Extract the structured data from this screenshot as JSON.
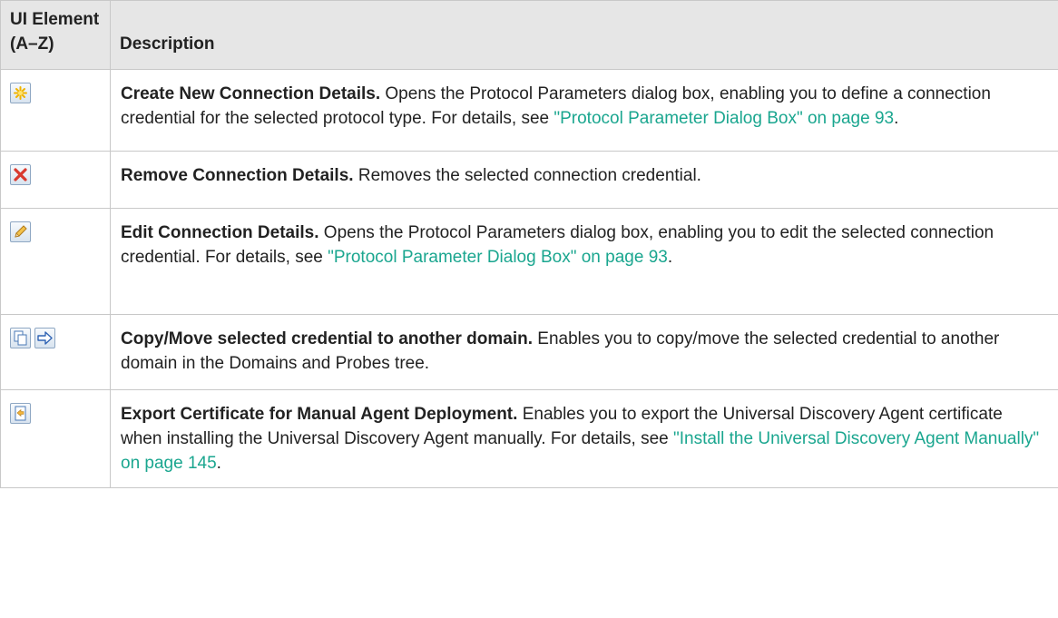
{
  "header": {
    "col1": "UI Element (A–Z)",
    "col2": "Description"
  },
  "rows": [
    {
      "icon": "new-star-icon",
      "title": "Create New Connection Details.",
      "text": " Opens the Protocol Parameters dialog box, enabling you to define a connection credential for the selected protocol type. For details, see ",
      "link": "\"Protocol Parameter Dialog Box\" on page 93",
      "tail": "."
    },
    {
      "icon": "remove-x-icon",
      "title": "Remove Connection Details.",
      "text": " Removes the selected connection credential.",
      "link": "",
      "tail": ""
    },
    {
      "icon": "edit-pencil-icon",
      "title": "Edit Connection Details.",
      "text": " Opens the Protocol Parameters dialog box, enabling you to edit the selected connection credential. For details, see ",
      "link": "\"Protocol Parameter Dialog Box\" on page 93",
      "tail": "."
    },
    {
      "icon": "copy-icon, move-arrow-icon",
      "title": "Copy/Move selected credential to another domain.",
      "text": " Enables you to copy/move the selected credential to another domain in the Domains and Probes tree.",
      "link": "",
      "tail": ""
    },
    {
      "icon": "export-certificate-icon",
      "title": "Export Certificate for Manual Agent Deployment.",
      "text": " Enables you to export the Universal Discovery Agent certificate when installing the Universal Discovery Agent manually. For details, see ",
      "link": "\"Install the Universal Discovery Agent Manually\" on page 145",
      "tail": "."
    }
  ],
  "colors": {
    "header_bg": "#e6e6e6",
    "border": "#c8c8c8",
    "link": "#1aa68f"
  }
}
